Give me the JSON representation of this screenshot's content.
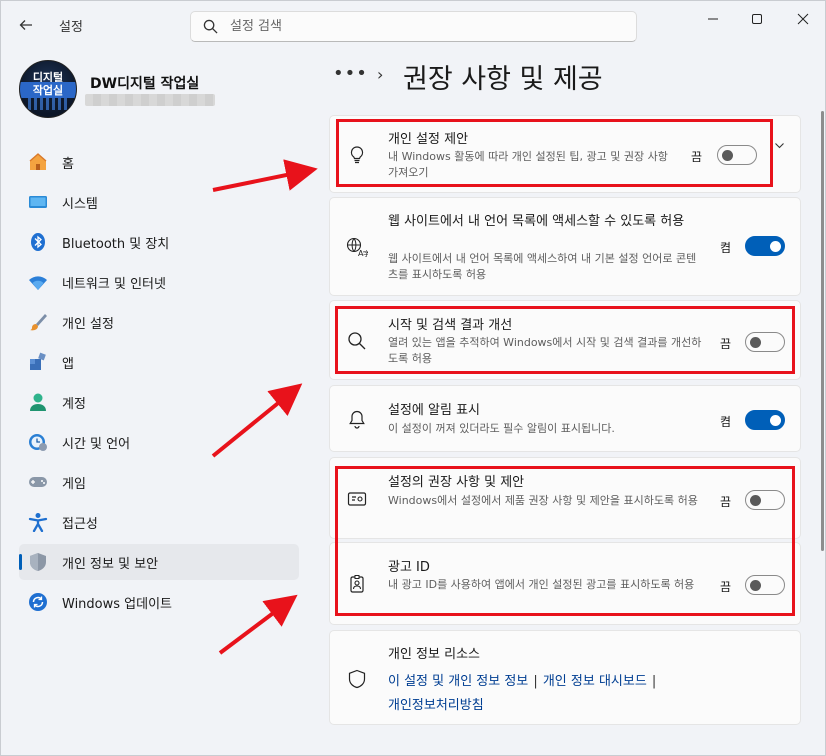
{
  "window": {
    "app_title": "설정"
  },
  "search": {
    "placeholder": "설정 검색"
  },
  "profile": {
    "avatar_line1": "디지털",
    "avatar_line2": "작업실",
    "name": "DW디지털 작업실"
  },
  "sidebar": {
    "items": [
      {
        "label": "홈",
        "icon": "home-icon",
        "active": false
      },
      {
        "label": "시스템",
        "icon": "system-icon",
        "active": false
      },
      {
        "label": "Bluetooth 및 장치",
        "icon": "bluetooth-icon",
        "active": false
      },
      {
        "label": "네트워크 및 인터넷",
        "icon": "wifi-icon",
        "active": false
      },
      {
        "label": "개인 설정",
        "icon": "brush-icon",
        "active": false
      },
      {
        "label": "앱",
        "icon": "apps-icon",
        "active": false
      },
      {
        "label": "계정",
        "icon": "account-icon",
        "active": false
      },
      {
        "label": "시간 및 언어",
        "icon": "clock-globe-icon",
        "active": false
      },
      {
        "label": "게임",
        "icon": "gamepad-icon",
        "active": false
      },
      {
        "label": "접근성",
        "icon": "accessibility-icon",
        "active": false
      },
      {
        "label": "개인 정보 및 보안",
        "icon": "shield-icon",
        "active": true
      },
      {
        "label": "Windows 업데이트",
        "icon": "update-icon",
        "active": false
      }
    ]
  },
  "header": {
    "more": "•••",
    "breadcrumb_chevron": "›",
    "title": "권장 사항 및 제공"
  },
  "cards": [
    {
      "title": "개인 설정 제안",
      "desc": "내 Windows 활동에 따라 개인 설정된 팁, 광고 및 권장 사항 가져오기",
      "state": "끔",
      "on": false
    },
    {
      "title": "웹 사이트에서 내 언어 목록에 액세스할 수 있도록 허용",
      "desc": "웹 사이트에서 내 언어 목록에 액세스하여 내 기본 설정 언어로 콘텐츠를 표시하도록 허용",
      "state": "켬",
      "on": true
    },
    {
      "title": "시작 및 검색 결과 개선",
      "desc": "열려 있는 앱을 추적하여 Windows에서 시작 및 검색 결과를 개선하도록 허용",
      "state": "끔",
      "on": false
    },
    {
      "title": "설정에 알림 표시",
      "desc": "이 설정이 꺼져 있더라도 필수 알림이 표시됩니다.",
      "state": "켬",
      "on": true
    },
    {
      "title": "설정의 권장 사항 및 제안",
      "desc": "Windows에서 설정에서 제품 권장 사항 및 제안을 표시하도록 허용",
      "state": "끔",
      "on": false
    },
    {
      "title": "광고 ID",
      "desc": "내 광고 ID를 사용하여 앱에서 개인 설정된 광고를 표시하도록 허용",
      "state": "끔",
      "on": false
    }
  ],
  "privacy": {
    "title": "개인 정보 리소스",
    "link1": "이 설정 및 개인 정보 정보",
    "link2": "개인 정보 대시보드",
    "link3": "개인정보처리방침",
    "separator": "|"
  },
  "colors": {
    "accent": "#005fb8",
    "highlight_red": "#e8121b"
  }
}
